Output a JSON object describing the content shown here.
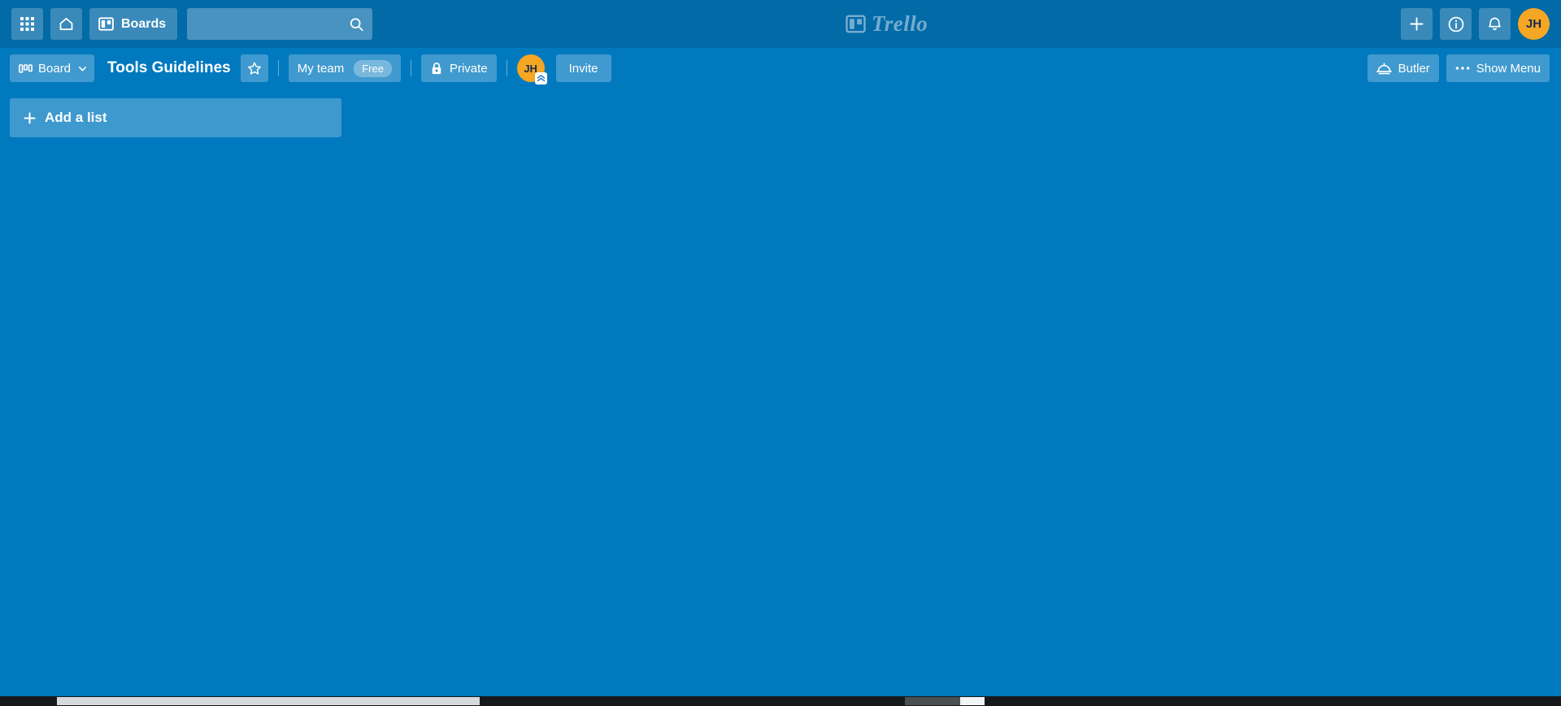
{
  "colors": {
    "top_bar": "#026aa7",
    "board_background": "#0079bf",
    "avatar": "#f5a623",
    "button_overlay": "rgba(255,255,255,0.25)",
    "bottom_strip": "#15191c"
  },
  "top_bar": {
    "apps_icon": "grid-apps-icon",
    "home_icon": "home-icon",
    "boards_icon": "boards-icon",
    "boards_label": "Boards",
    "search": {
      "value": "",
      "placeholder": "",
      "icon": "search-icon"
    },
    "logo": {
      "icon": "trello-board-icon",
      "wordmark": "Trello"
    },
    "add_icon": "plus-icon",
    "info_icon": "info-circle-icon",
    "notifications_icon": "bell-icon",
    "avatar_initials": "JH"
  },
  "board_header": {
    "view_button": {
      "icon": "board-columns-icon",
      "label": "Board",
      "chevron": "chevron-down-icon"
    },
    "title": "Tools Guidelines",
    "star_icon": "star-outline-icon",
    "team": {
      "name": "My team",
      "plan_badge": "Free"
    },
    "visibility": {
      "icon": "lock-icon",
      "label": "Private"
    },
    "member": {
      "initials": "JH",
      "badge_icon": "atlassian-badge-icon"
    },
    "invite_label": "Invite",
    "butler": {
      "icon": "butler-bell-icon",
      "label": "Butler"
    },
    "show_menu": {
      "icon": "ellipsis-icon",
      "label": "Show Menu"
    }
  },
  "board_canvas": {
    "add_list": {
      "icon": "plus-icon",
      "label": "Add a list"
    },
    "lists": []
  },
  "bottom": {
    "horizontal_scrollbar": "board-hscrollbar"
  }
}
